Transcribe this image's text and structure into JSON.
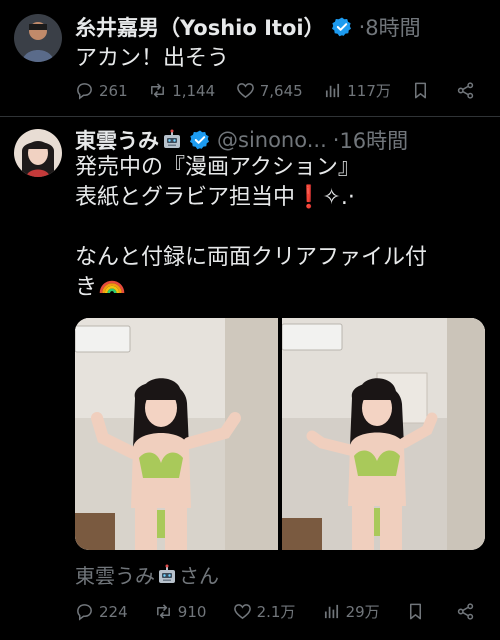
{
  "tweet1": {
    "name": "糸井嘉男（Yoshio Itoi）",
    "separator": "·",
    "time": "8時間",
    "text": "アカン！出そう",
    "replies": "261",
    "retweets": "1,144",
    "likes": "7,645",
    "views": "117万"
  },
  "tweet2": {
    "name": "東雲うみ",
    "handle": "@sinono...",
    "separator": "·",
    "time": "16時間",
    "text": "発売中の『漫画アクション』\n表紙とグラビア担当中❗️✧.·\n\nなんと付録に両面クリアファイル付\nき",
    "tagged_name": "東雲うみ",
    "tagged_suffix": "さん",
    "replies": "224",
    "retweets": "910",
    "likes": "2.1万",
    "views": "29万"
  },
  "colors": {
    "background": "#000000",
    "text": "#e7e9ea",
    "secondary": "#71767b",
    "verified": "#1d9bf0"
  },
  "icons": [
    "verified-icon",
    "reply-icon",
    "retweet-icon",
    "like-icon",
    "views-icon",
    "bookmark-icon",
    "share-icon",
    "robot-icon",
    "rainbow-icon"
  ]
}
